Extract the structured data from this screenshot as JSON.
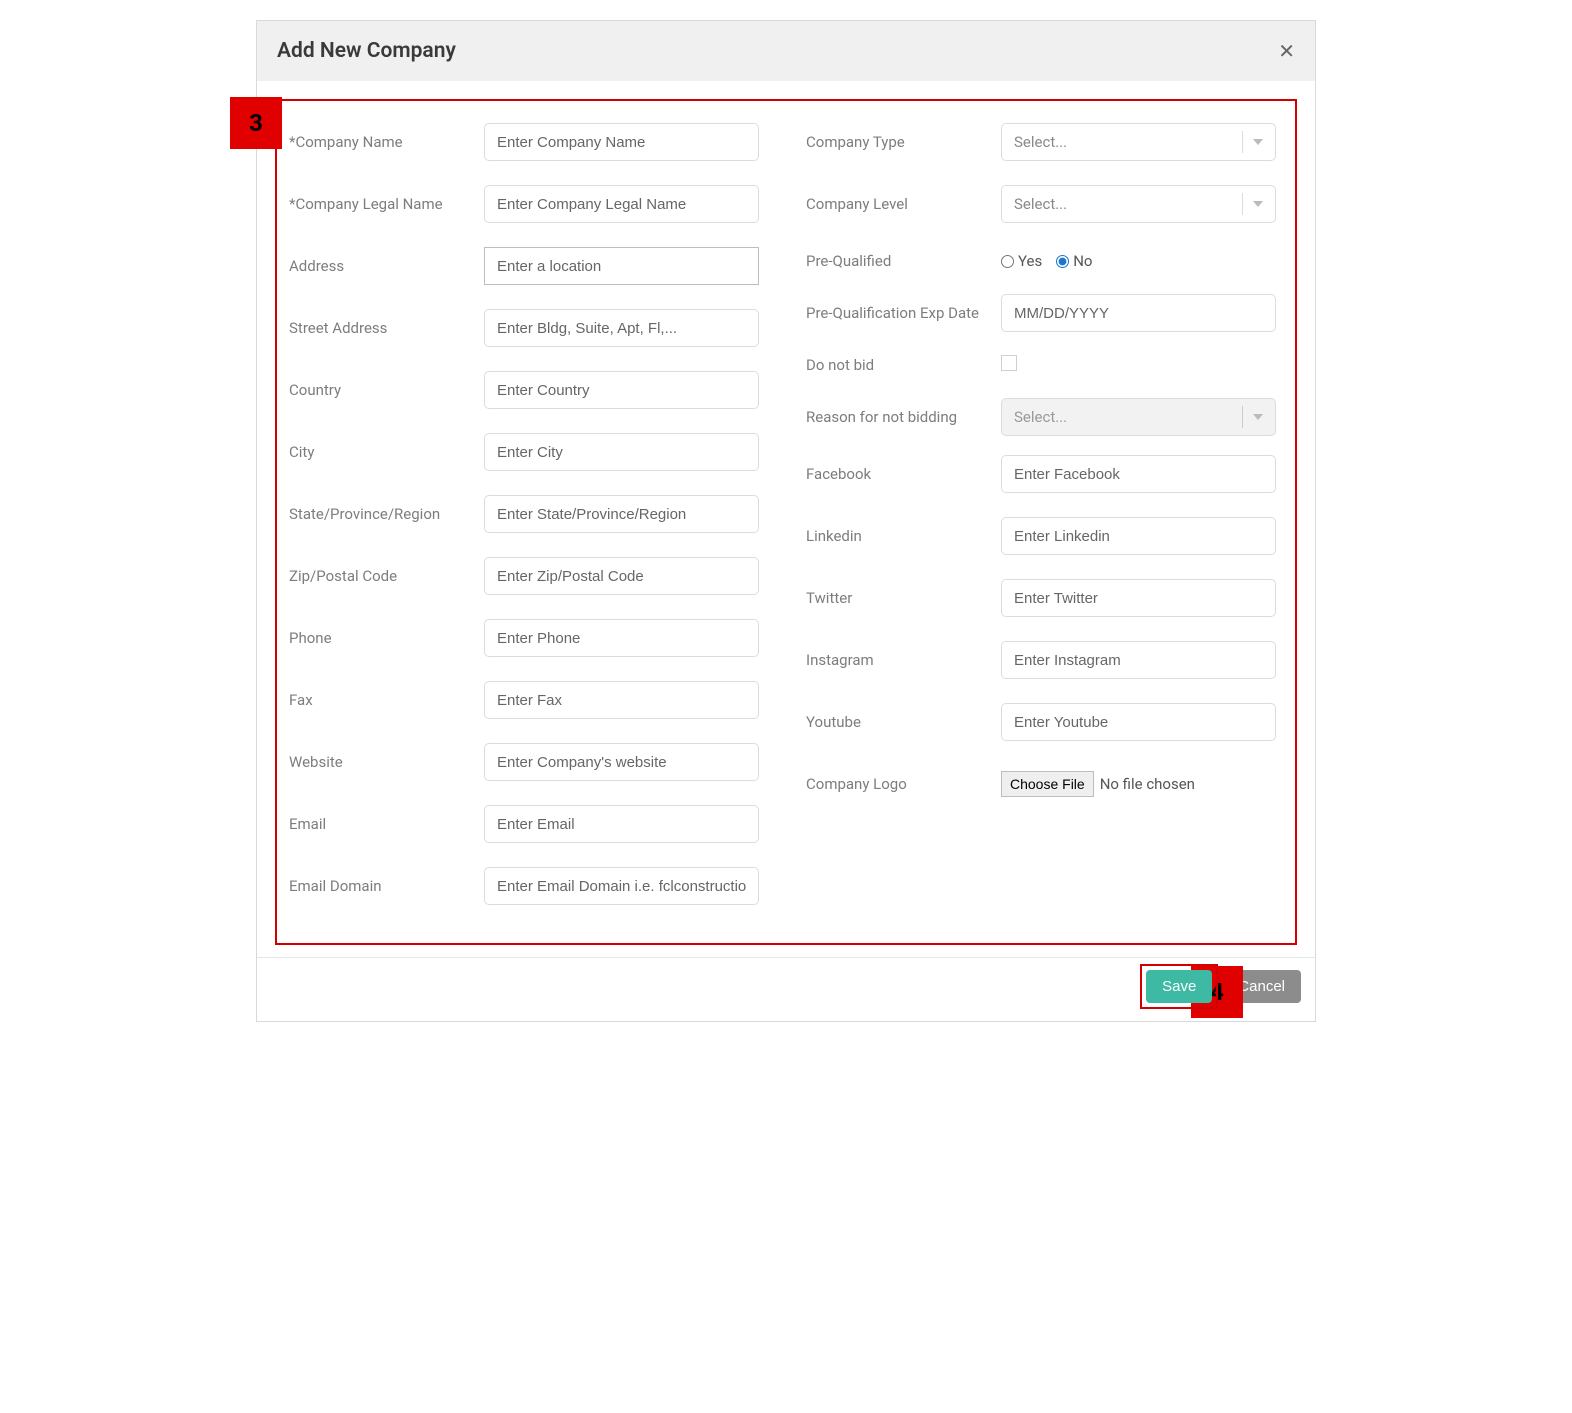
{
  "modal": {
    "title": "Add New Company"
  },
  "markers": {
    "m3": "3",
    "m4": "4"
  },
  "left": {
    "company_name": {
      "label": "*Company Name",
      "placeholder": "Enter Company Name"
    },
    "company_legal_name": {
      "label": "*Company Legal Name",
      "placeholder": "Enter Company Legal Name"
    },
    "address": {
      "label": "Address",
      "placeholder": "Enter a location"
    },
    "street_address": {
      "label": "Street Address",
      "placeholder": "Enter Bldg, Suite, Apt, Fl,..."
    },
    "country": {
      "label": "Country",
      "placeholder": "Enter Country"
    },
    "city": {
      "label": "City",
      "placeholder": "Enter City"
    },
    "state": {
      "label": "State/Province/Region",
      "placeholder": "Enter State/Province/Region"
    },
    "zip": {
      "label": "Zip/Postal Code",
      "placeholder": "Enter Zip/Postal Code"
    },
    "phone": {
      "label": "Phone",
      "placeholder": "Enter Phone"
    },
    "fax": {
      "label": "Fax",
      "placeholder": "Enter Fax"
    },
    "website": {
      "label": "Website",
      "placeholder": "Enter Company's website"
    },
    "email": {
      "label": "Email",
      "placeholder": "Enter Email"
    },
    "email_domain": {
      "label": "Email Domain",
      "placeholder": "Enter Email Domain i.e. fclconstructio"
    }
  },
  "right": {
    "company_type": {
      "label": "Company Type",
      "placeholder": "Select..."
    },
    "company_level": {
      "label": "Company Level",
      "placeholder": "Select..."
    },
    "pre_qualified": {
      "label": "Pre-Qualified",
      "yes": "Yes",
      "no": "No",
      "selected": "No"
    },
    "pre_qual_exp": {
      "label": "Pre-Qualification Exp Date",
      "placeholder": "MM/DD/YYYY"
    },
    "do_not_bid": {
      "label": "Do not bid",
      "checked": false
    },
    "reason_not_bidding": {
      "label": "Reason for not bidding",
      "placeholder": "Select..."
    },
    "facebook": {
      "label": "Facebook",
      "placeholder": "Enter Facebook"
    },
    "linkedin": {
      "label": "Linkedin",
      "placeholder": "Enter Linkedin"
    },
    "twitter": {
      "label": "Twitter",
      "placeholder": "Enter Twitter"
    },
    "instagram": {
      "label": "Instagram",
      "placeholder": "Enter Instagram"
    },
    "youtube": {
      "label": "Youtube",
      "placeholder": "Enter Youtube"
    },
    "company_logo": {
      "label": "Company Logo",
      "button": "Choose File",
      "status": "No file chosen"
    }
  },
  "footer": {
    "save": "Save",
    "cancel": "Cancel"
  }
}
